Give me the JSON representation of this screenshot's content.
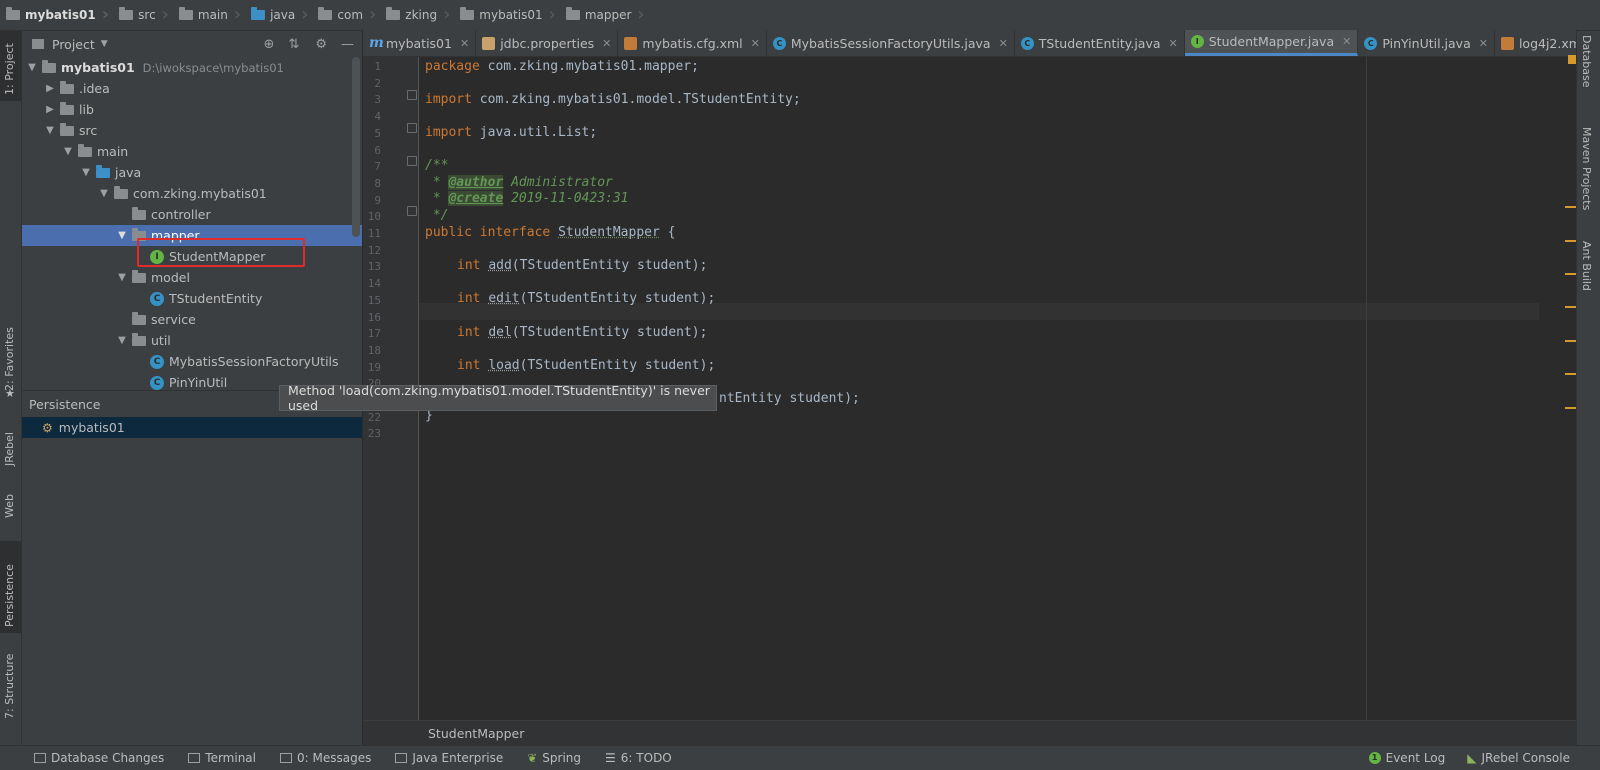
{
  "breadcrumbs": [
    "mybatis01",
    "src",
    "main",
    "java",
    "com",
    "zking",
    "mybatis01",
    "mapper"
  ],
  "left_stripe": [
    "1: Project",
    "2: Favorites",
    "JRebel",
    "Web",
    "Persistence",
    "7: Structure"
  ],
  "right_stripe": [
    "Database",
    "Maven Projects",
    "Ant Build"
  ],
  "project_panel": {
    "title": "Project",
    "root_name": "mybatis01",
    "root_path": "D:\\iwokspace\\mybatis01",
    "items": [
      {
        "label": ".idea",
        "kind": "folder"
      },
      {
        "label": "lib",
        "kind": "folder"
      },
      {
        "label": "src",
        "kind": "folder"
      },
      {
        "label": "main",
        "kind": "folder"
      },
      {
        "label": "java",
        "kind": "folder"
      },
      {
        "label": "com.zking.mybatis01",
        "kind": "package"
      },
      {
        "label": "controller",
        "kind": "package"
      },
      {
        "label": "mapper",
        "kind": "package"
      },
      {
        "label": "StudentMapper",
        "kind": "interface"
      },
      {
        "label": "model",
        "kind": "package"
      },
      {
        "label": "TStudentEntity",
        "kind": "class"
      },
      {
        "label": "service",
        "kind": "package"
      },
      {
        "label": "util",
        "kind": "package"
      },
      {
        "label": "MybatisSessionFactoryUtils",
        "kind": "class"
      },
      {
        "label": "PinYinUtil",
        "kind": "class"
      }
    ]
  },
  "persistence_panel": {
    "title": "Persistence",
    "item": "mybatis01"
  },
  "tabs": [
    {
      "label": "mybatis01",
      "icon": "m"
    },
    {
      "label": "jdbc.properties",
      "icon": "prop"
    },
    {
      "label": "mybatis.cfg.xml",
      "icon": "xml"
    },
    {
      "label": "MybatisSessionFactoryUtils.java",
      "icon": "c"
    },
    {
      "label": "TStudentEntity.java",
      "icon": "c"
    },
    {
      "label": "StudentMapper.java",
      "icon": "i",
      "active": true
    },
    {
      "label": "PinYinUtil.java",
      "icon": "c"
    },
    {
      "label": "log4j2.xml",
      "icon": "xml"
    }
  ],
  "code": {
    "line_numbers": [
      "1",
      "2",
      "3",
      "4",
      "5",
      "6",
      "7",
      "8",
      "9",
      "10",
      "11",
      "12",
      "13",
      "14",
      "15",
      "16",
      "17",
      "18",
      "19",
      "20",
      "21",
      "22",
      "23"
    ],
    "l1_kw": "package",
    "l1_rest": " com.zking.mybatis01.mapper;",
    "l3_kw": "import",
    "l3_rest": " com.zking.mybatis01.model.TStudentEntity;",
    "l5_kw": "import",
    "l5_rest": " java.util.List;",
    "l7": "/**",
    "l8_star": " * ",
    "l8_tag": "@author",
    "l8_text": " Administrator",
    "l9_star": " * ",
    "l9_tag": "@create",
    "l9_text": " 2019-11-0423:31",
    "l10": " */",
    "l11_kw": "public interface",
    "l11_name": "StudentMapper",
    "l11_brace": " {",
    "l13_kw": "int",
    "l13_m": "add",
    "l13_rest": "(TStudentEntity student);",
    "l15_kw": "int",
    "l15_m": "edit",
    "l15_rest": "(TStudentEntity student);",
    "l17_kw": "int",
    "l17_m": "del",
    "l17_rest": "(TStudentEntity student);",
    "l19_kw": "int",
    "l19_m": "load",
    "l19_rest": "(TStudentEntity student);",
    "l21_partial": "ntEntity student);",
    "l22": "}"
  },
  "tooltip": "Method 'load(com.zking.mybatis01.model.TStudentEntity)' is never used",
  "editor_breadcrumb": "StudentMapper",
  "status": {
    "left": [
      "Database Changes",
      "Terminal",
      "0: Messages",
      "Java Enterprise",
      "Spring",
      "6: TODO"
    ],
    "right": [
      "Event Log",
      "JRebel Console"
    ]
  },
  "colors": {
    "selection": "#4b6eaf",
    "highlight_box": "#e02b2b",
    "interface_icon": "#62b543",
    "class_icon": "#3592c4",
    "keyword": "#cc7832",
    "doc_comment": "#629755"
  }
}
